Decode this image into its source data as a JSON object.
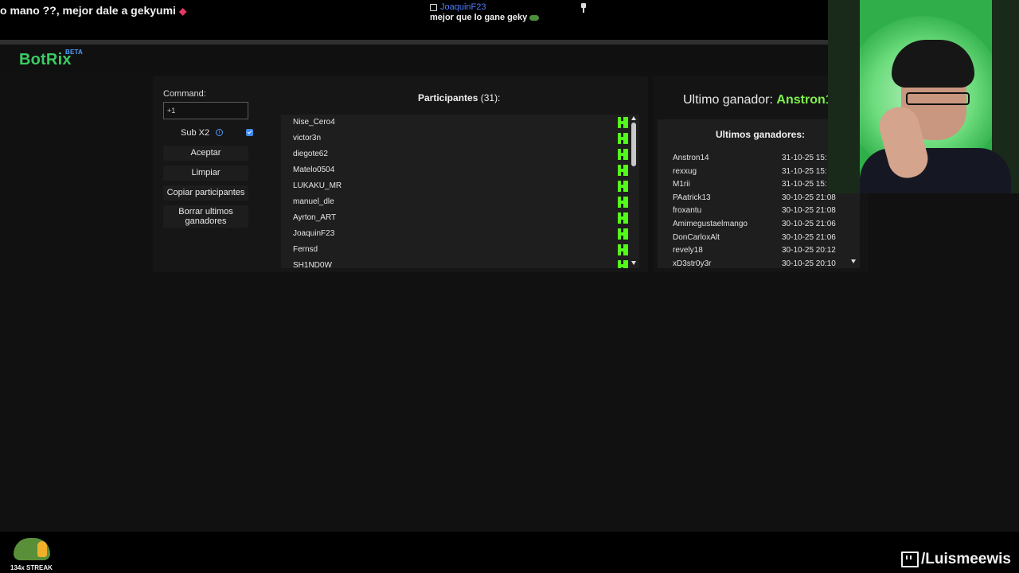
{
  "chat": {
    "left_message": "o mano ??, mejor dale a gekyumi",
    "mid_user": "JoaquinF23",
    "mid_message": "mejor que lo gane geky"
  },
  "header": {
    "logo": "BotRix",
    "beta": "BETA"
  },
  "command": {
    "label": "Command:",
    "value": "+1"
  },
  "sub": {
    "label": "Sub X2",
    "checked": true
  },
  "buttons": {
    "aceptar": "Aceptar",
    "limpiar": "Limpiar",
    "copiar": "Copiar participantes",
    "borrar_line1": "Borrar ultimos",
    "borrar_line2": "ganadores"
  },
  "participants": {
    "title": "Participantes",
    "count": "(31):",
    "names": [
      "Nise_Cero4",
      "victor3n",
      "diegote62",
      "Matelo0504",
      "LUKAKU_MR",
      "manuel_dle",
      "Ayrton_ART",
      "JoaquinF23",
      "Fernsd",
      "SH1ND0W"
    ]
  },
  "last_winner": {
    "label": "Ultimo ganador:",
    "name": "Anstron1"
  },
  "winners": {
    "title": "Ultimos ganadores:",
    "rows": [
      {
        "name": "Anstron14",
        "date": "31-10-25 15:"
      },
      {
        "name": "rexxug",
        "date": "31-10-25 15:"
      },
      {
        "name": "M1rii",
        "date": "31-10-25 15:"
      },
      {
        "name": "PAatrick13",
        "date": "30-10-25 21:08"
      },
      {
        "name": "froxantu",
        "date": "30-10-25 21:08"
      },
      {
        "name": "Amimegustaelmango",
        "date": "30-10-25 21:06"
      },
      {
        "name": "DonCarloxAlt",
        "date": "30-10-25 21:06"
      },
      {
        "name": "revely18",
        "date": "30-10-25 20:12"
      },
      {
        "name": "xD3str0y3r",
        "date": "30-10-25 20:10"
      }
    ]
  },
  "footer": {
    "streak": "134x STREAK",
    "handle": "/Luismeewis"
  },
  "colors": {
    "brand": "#3ccb63",
    "kick": "#53fc18",
    "winner": "#7ff04f",
    "accent": "#3d8bf0"
  }
}
